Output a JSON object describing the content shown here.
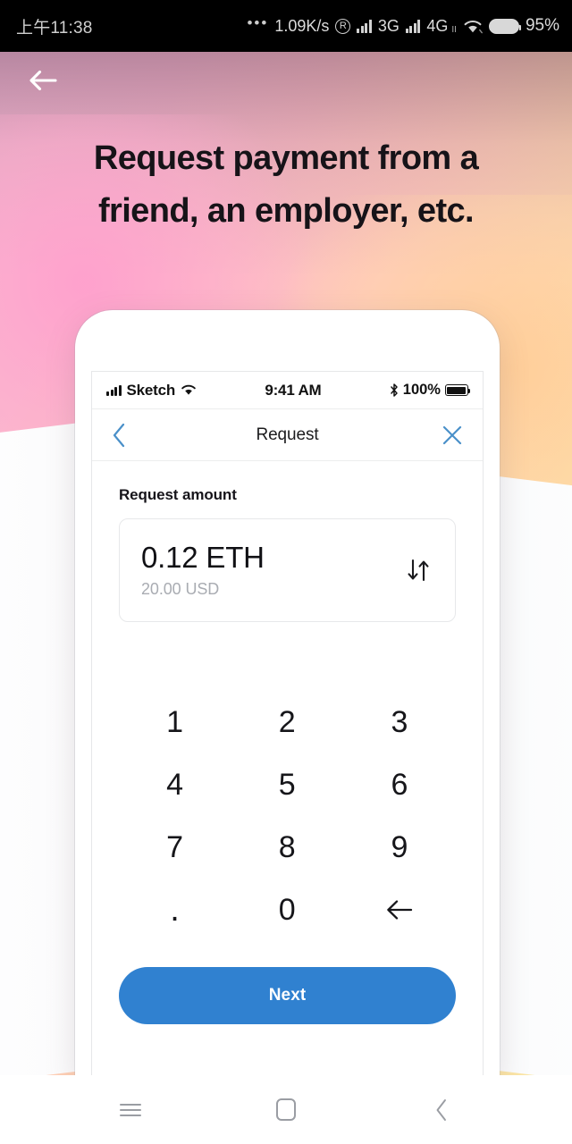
{
  "system_status_bar": {
    "clock": "上午11:38",
    "overflow_dots": "•••",
    "network_speed": "1.09K/s",
    "roaming_badge": "R",
    "sim1_network": "3G",
    "sim2_network": "4G",
    "sim2_network_sub": "II",
    "battery_percent": "95%",
    "icons": [
      "signal-bars-icon",
      "wifi-icon",
      "battery-icon"
    ]
  },
  "poster": {
    "back_label": "Back",
    "headline": "Request payment from a friend, an employer, etc.",
    "headline_line1": "Request payment from a",
    "headline_line2": "friend, an employer, etc.",
    "colors": {
      "gradient_pink": "#f6b9d4",
      "gradient_peach": "#ffc7bd",
      "gradient_amber": "#fbe7a6",
      "headline_text": "#161318"
    }
  },
  "phone_mockup": {
    "ios_status_bar": {
      "carrier": "Sketch",
      "time": "9:41 AM",
      "battery_percent": "100%",
      "icons": [
        "cellular-bars-icon",
        "wifi-icon",
        "bluetooth-icon",
        "battery-icon"
      ]
    },
    "nav": {
      "title": "Request",
      "back_icon": "chevron-left-icon",
      "close_icon": "close-x-icon",
      "accent_color": "#4a90c9"
    },
    "form": {
      "field_label": "Request amount",
      "amount_primary": "0.12 ETH",
      "amount_secondary": "20.00 USD",
      "swap_icon": "swap-vertical-icon",
      "primary_color": "#101014",
      "secondary_color": "#a9acb2"
    },
    "keypad": {
      "keys": [
        "1",
        "2",
        "3",
        "4",
        "5",
        "6",
        "7",
        "8",
        "9",
        ".",
        "0",
        "⌫"
      ],
      "backspace_icon": "backspace-arrow-icon"
    },
    "primary_action": {
      "label": "Next",
      "color": "#3081d0",
      "text_color": "#ffffff"
    }
  },
  "android_nav_bar": {
    "recents_label": "Recents",
    "home_label": "Home",
    "back_label": "Back",
    "icons": [
      "menu-lines-icon",
      "home-square-icon",
      "chevron-left-icon"
    ],
    "icon_color": "#9a9da3"
  }
}
